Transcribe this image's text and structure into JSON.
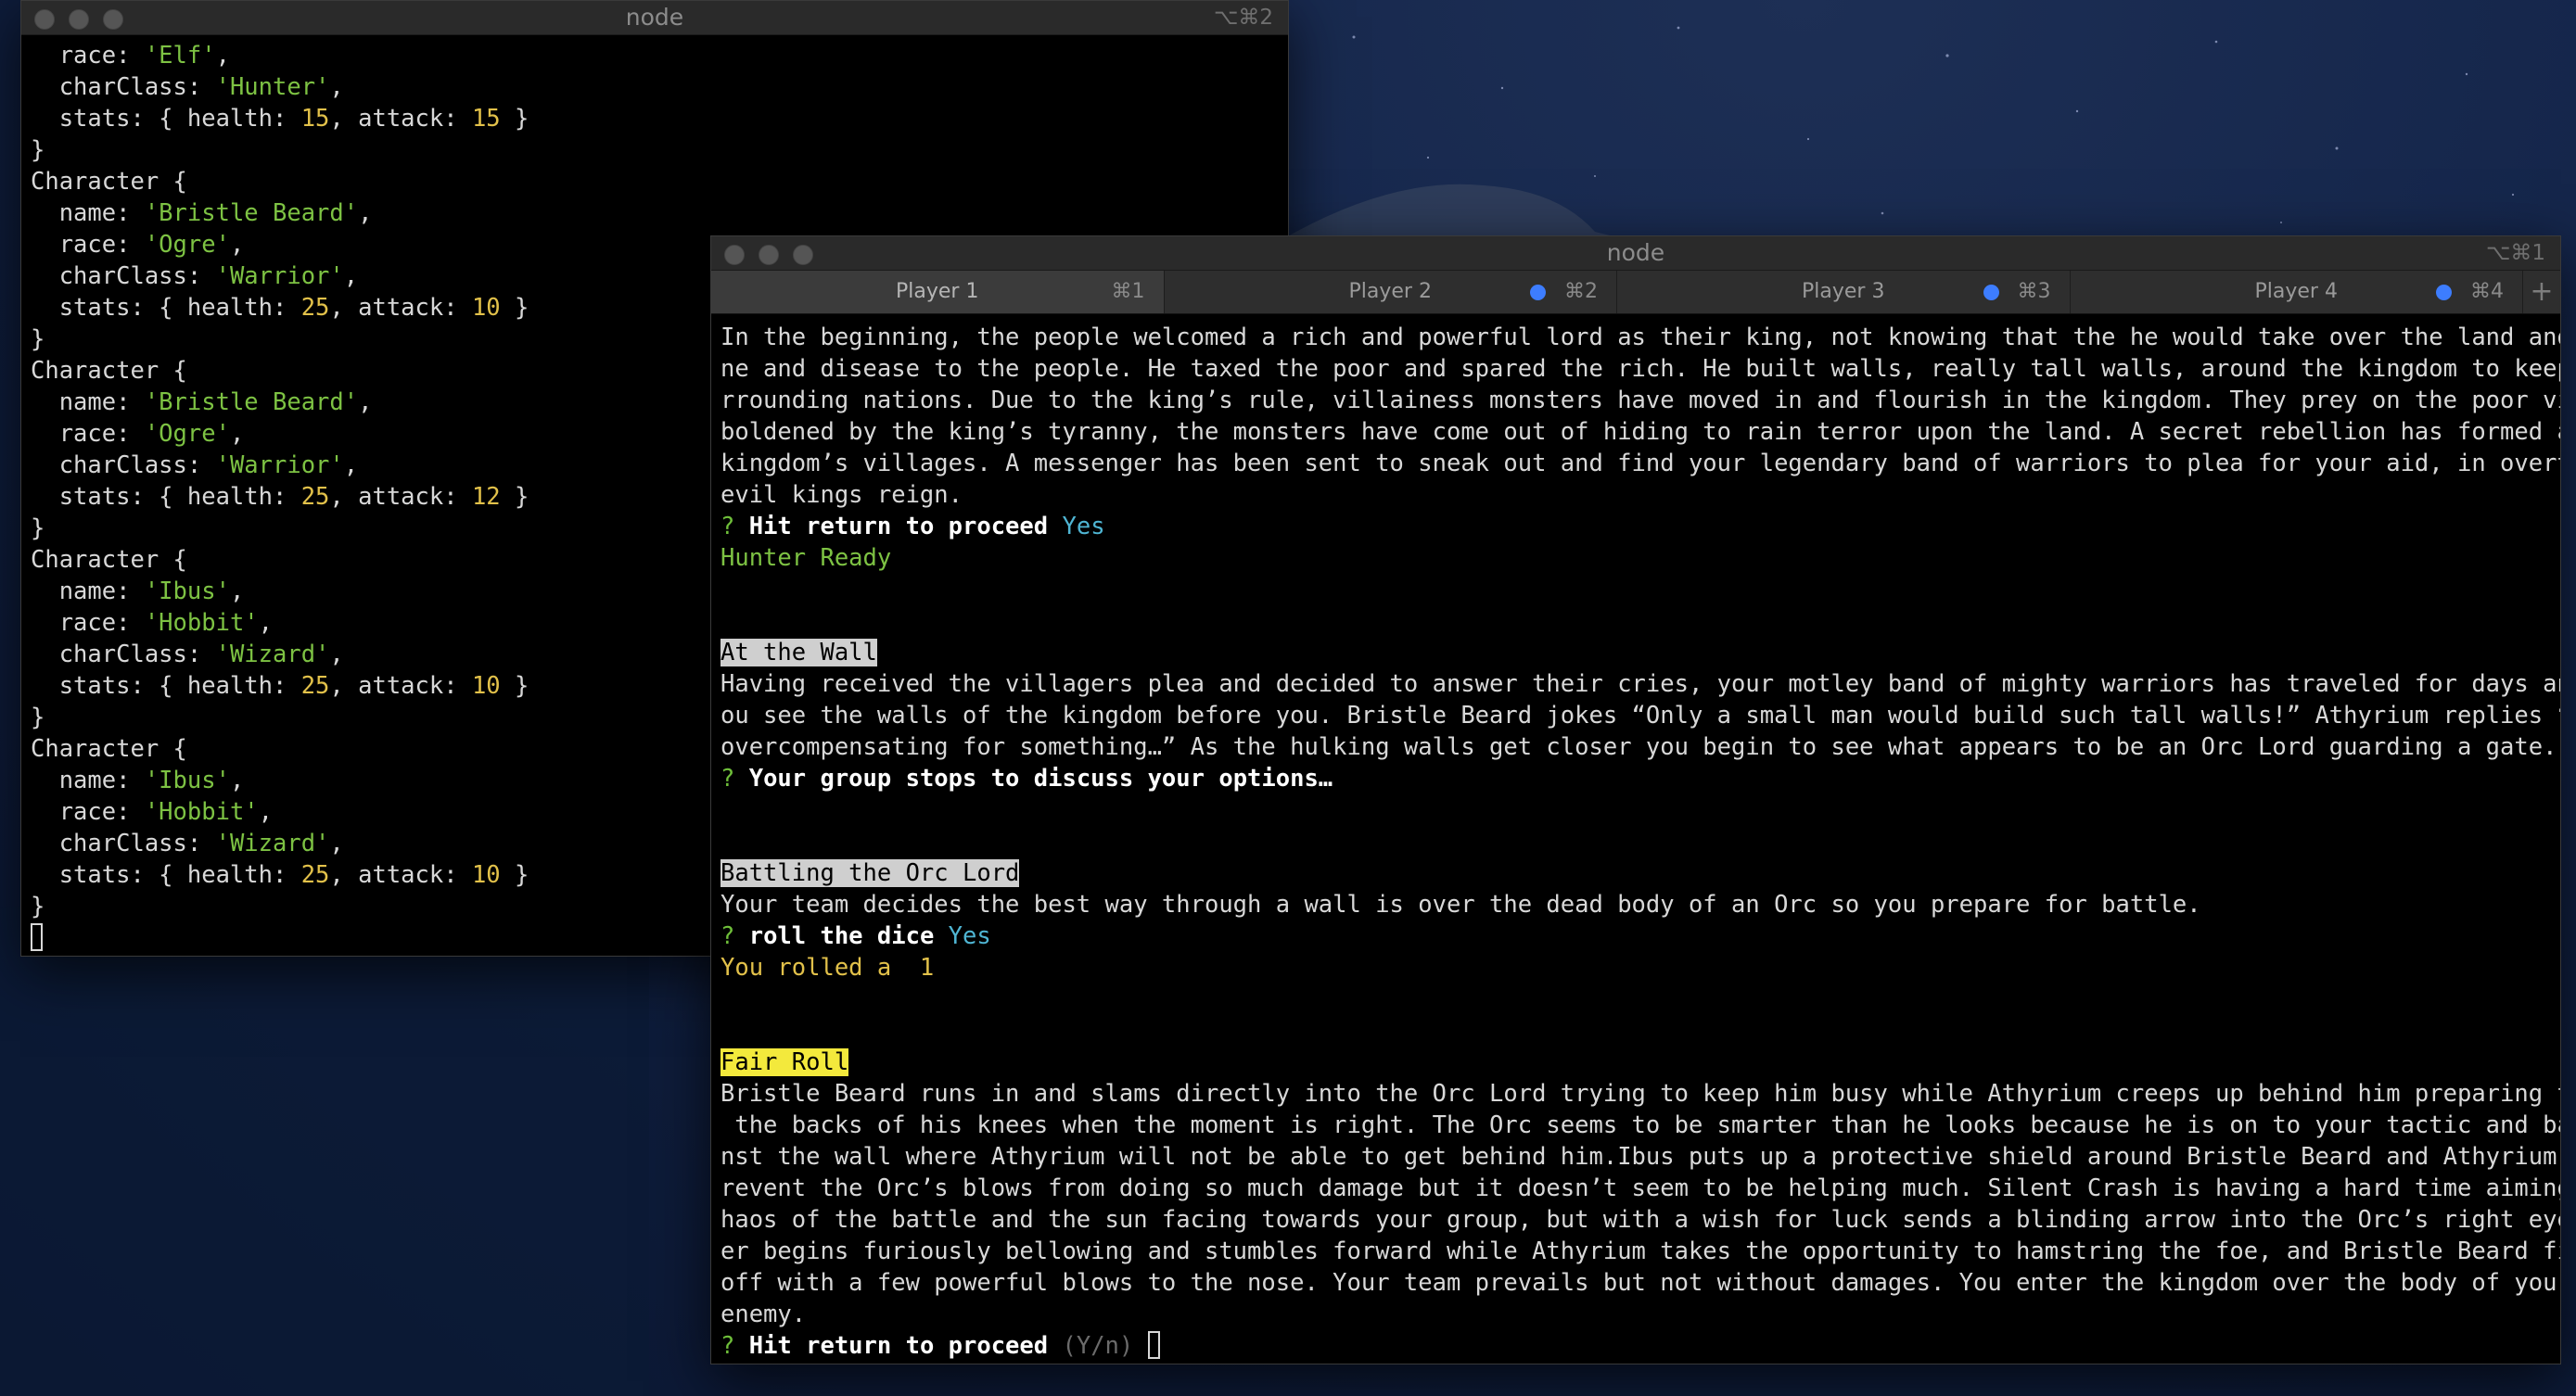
{
  "left_window": {
    "title": "node",
    "shortcut": "⌥⌘2",
    "lines": [
      [
        [
          "  race: ",
          ""
        ],
        [
          "'Elf'",
          "str"
        ],
        [
          ",",
          ""
        ]
      ],
      [
        [
          "  charClass: ",
          ""
        ],
        [
          "'Hunter'",
          "str"
        ],
        [
          ",",
          ""
        ]
      ],
      [
        [
          "  stats: { health: ",
          ""
        ],
        [
          "15",
          "num"
        ],
        [
          ", attack: ",
          ""
        ],
        [
          "15",
          "num"
        ],
        [
          " }",
          ""
        ]
      ],
      [
        [
          "}",
          ""
        ]
      ],
      [
        [
          "Character {",
          ""
        ]
      ],
      [
        [
          "  name: ",
          ""
        ],
        [
          "'Bristle Beard'",
          "str"
        ],
        [
          ",",
          ""
        ]
      ],
      [
        [
          "  race: ",
          ""
        ],
        [
          "'Ogre'",
          "str"
        ],
        [
          ",",
          ""
        ]
      ],
      [
        [
          "  charClass: ",
          ""
        ],
        [
          "'Warrior'",
          "str"
        ],
        [
          ",",
          ""
        ]
      ],
      [
        [
          "  stats: { health: ",
          ""
        ],
        [
          "25",
          "num"
        ],
        [
          ", attack: ",
          ""
        ],
        [
          "10",
          "num"
        ],
        [
          " }",
          ""
        ]
      ],
      [
        [
          "}",
          ""
        ]
      ],
      [
        [
          "Character {",
          ""
        ]
      ],
      [
        [
          "  name: ",
          ""
        ],
        [
          "'Bristle Beard'",
          "str"
        ],
        [
          ",",
          ""
        ]
      ],
      [
        [
          "  race: ",
          ""
        ],
        [
          "'Ogre'",
          "str"
        ],
        [
          ",",
          ""
        ]
      ],
      [
        [
          "  charClass: ",
          ""
        ],
        [
          "'Warrior'",
          "str"
        ],
        [
          ",",
          ""
        ]
      ],
      [
        [
          "  stats: { health: ",
          ""
        ],
        [
          "25",
          "num"
        ],
        [
          ", attack: ",
          ""
        ],
        [
          "12",
          "num"
        ],
        [
          " }",
          ""
        ]
      ],
      [
        [
          "}",
          ""
        ]
      ],
      [
        [
          "Character {",
          ""
        ]
      ],
      [
        [
          "  name: ",
          ""
        ],
        [
          "'Ibus'",
          "str"
        ],
        [
          ",",
          ""
        ]
      ],
      [
        [
          "  race: ",
          ""
        ],
        [
          "'Hobbit'",
          "str"
        ],
        [
          ",",
          ""
        ]
      ],
      [
        [
          "  charClass: ",
          ""
        ],
        [
          "'Wizard'",
          "str"
        ],
        [
          ",",
          ""
        ]
      ],
      [
        [
          "  stats: { health: ",
          ""
        ],
        [
          "25",
          "num"
        ],
        [
          ", attack: ",
          ""
        ],
        [
          "10",
          "num"
        ],
        [
          " }",
          ""
        ]
      ],
      [
        [
          "}",
          ""
        ]
      ],
      [
        [
          "Character {",
          ""
        ]
      ],
      [
        [
          "  name: ",
          ""
        ],
        [
          "'Ibus'",
          "str"
        ],
        [
          ",",
          ""
        ]
      ],
      [
        [
          "  race: ",
          ""
        ],
        [
          "'Hobbit'",
          "str"
        ],
        [
          ",",
          ""
        ]
      ],
      [
        [
          "  charClass: ",
          ""
        ],
        [
          "'Wizard'",
          "str"
        ],
        [
          ",",
          ""
        ]
      ],
      [
        [
          "  stats: { health: ",
          ""
        ],
        [
          "25",
          "num"
        ],
        [
          ", attack: ",
          ""
        ],
        [
          "10",
          "num"
        ],
        [
          " }",
          ""
        ]
      ],
      [
        [
          "}",
          ""
        ]
      ],
      [
        [
          "",
          "cursor"
        ]
      ]
    ]
  },
  "right_window": {
    "title": "node",
    "shortcut": "⌥⌘1",
    "tabs": [
      {
        "label": "Player 1",
        "key": "⌘1",
        "active": true,
        "dot": false
      },
      {
        "label": "Player 2",
        "key": "⌘2",
        "active": false,
        "dot": true
      },
      {
        "label": "Player 3",
        "key": "⌘3",
        "active": false,
        "dot": true
      },
      {
        "label": "Player 4",
        "key": "⌘4",
        "active": false,
        "dot": true
      }
    ],
    "new_tab_label": "+",
    "lines": [
      [
        [
          "In the beginning, the people welcomed a rich and powerful lord as their king, not knowing that the he would take over the land and bring fami",
          ""
        ]
      ],
      [
        [
          "ne and disease to the people. He taxed the poor and spared the rich. He built walls, really tall walls, around the kingdom to keep out the su",
          ""
        ]
      ],
      [
        [
          "rrounding nations. Due to the king’s rule, villainess monsters have moved in and flourish in the kingdom. They prey on the poor villagers. Em",
          ""
        ]
      ],
      [
        [
          "boldened by the king’s tyranny, the monsters have come out of hiding to rain terror upon the land. A secret rebellion has formed amongst the",
          ""
        ]
      ],
      [
        [
          "kingdom’s villages. A messenger has been sent to sneak out and find your legendary band of warriors to plea for your aid, in overturning the",
          ""
        ]
      ],
      [
        [
          "evil kings reign.",
          ""
        ]
      ],
      [
        [
          "? ",
          "q"
        ],
        [
          "Hit return to proceed",
          "bold"
        ],
        [
          " ",
          ""
        ],
        [
          "Yes",
          "ans"
        ]
      ],
      [
        [
          "Hunter Ready",
          "green"
        ]
      ],
      [
        [
          "",
          ""
        ]
      ],
      [
        [
          "",
          ""
        ]
      ],
      [
        [
          "At the Wall",
          "hl-grey"
        ]
      ],
      [
        [
          "Having received the villagers plea and decided to answer their cries, your motley band of mighty warriors has traveled for days and finally y",
          ""
        ]
      ],
      [
        [
          "ou see the walls of the kingdom before you. Bristle Beard jokes “Only a small man would build such tall walls!” Athyrium replies “definitely",
          ""
        ]
      ],
      [
        [
          "overcompensating for something…” As the hulking walls get closer you begin to see what appears to be an Orc Lord guarding a gate.",
          ""
        ]
      ],
      [
        [
          "? ",
          "q"
        ],
        [
          "Your group stops to discuss your options…",
          "bold"
        ]
      ],
      [
        [
          "",
          ""
        ]
      ],
      [
        [
          "",
          ""
        ]
      ],
      [
        [
          "Battling the Orc Lord",
          "hl-grey"
        ]
      ],
      [
        [
          "Your team decides the best way through a wall is over the dead body of an Orc so you prepare for battle.",
          ""
        ]
      ],
      [
        [
          "? ",
          "q"
        ],
        [
          "roll the dice",
          "bold"
        ],
        [
          " ",
          ""
        ],
        [
          "Yes",
          "ans"
        ]
      ],
      [
        [
          "You rolled a  1",
          "yellow"
        ]
      ],
      [
        [
          "",
          ""
        ]
      ],
      [
        [
          "",
          ""
        ]
      ],
      [
        [
          "Fair Roll",
          "hl-yellow"
        ]
      ],
      [
        [
          "Bristle Beard runs in and slams directly into the Orc Lord trying to keep him busy while Athyrium creeps up behind him preparing to cut in to",
          ""
        ]
      ],
      [
        [
          " the backs of his knees when the moment is right. The Orc seems to be smarter than he looks because he is on to your tactic and backs up agai",
          ""
        ]
      ],
      [
        [
          "nst the wall where Athyrium will not be able to get behind him.Ibus puts up a protective shield around Bristle Beard and Athyrium trying to p",
          ""
        ]
      ],
      [
        [
          "revent the Orc’s blows from doing so much damage but it doesn’t seem to be helping much. Silent Crash is having a hard time aiming with the c",
          ""
        ]
      ],
      [
        [
          "haos of the battle and the sun facing towards your group, but with a wish for luck sends a blinding arrow into the Orc’s right eye. The monst",
          ""
        ]
      ],
      [
        [
          "er begins furiously bellowing and stumbles forward while Athyrium takes the opportunity to hamstring the foe, and Bristle Beard finishes him",
          ""
        ]
      ],
      [
        [
          "off with a few powerful blows to the nose. Your team prevails but not without damages. You enter the kingdom over the body of your conquered",
          ""
        ]
      ],
      [
        [
          "enemy.",
          ""
        ]
      ],
      [
        [
          "? ",
          "q"
        ],
        [
          "Hit return to proceed",
          "bold"
        ],
        [
          " ",
          ""
        ],
        [
          "(Y/n)",
          "dim"
        ],
        [
          " ",
          ""
        ],
        [
          "",
          "cursor"
        ]
      ]
    ]
  }
}
